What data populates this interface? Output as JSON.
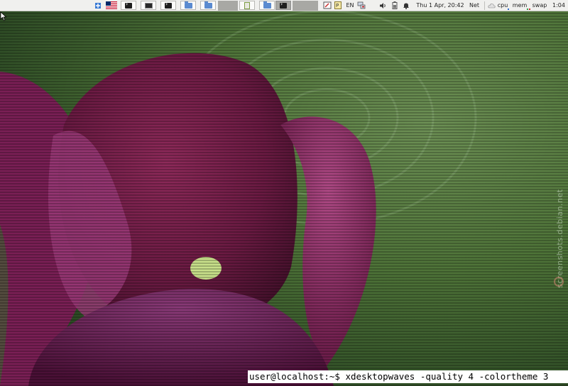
{
  "panel": {
    "apps": [
      {
        "name": "menu",
        "icon": "app-menu-icon"
      },
      {
        "name": "language-flag",
        "icon": "us-flag-icon"
      },
      {
        "name": "terminal",
        "icon": "terminal-icon"
      },
      {
        "name": "terminal-window",
        "icon": "terminal-window-icon"
      },
      {
        "name": "terminal-2",
        "icon": "terminal-icon"
      },
      {
        "name": "folder",
        "icon": "folder-icon"
      },
      {
        "name": "folder-2",
        "icon": "folder-icon"
      }
    ],
    "tasks": [
      {
        "icon": "notes-icon",
        "active": false
      },
      {
        "icon": "folder-icon",
        "active": false
      },
      {
        "icon": "terminal-icon",
        "active": true
      }
    ],
    "tray": {
      "keyboard_layout": "EN",
      "clock": "Thu  1 Apr, 20:42",
      "net_label": "Net",
      "cpu_label": "cpu",
      "mem_label": "mem",
      "swap_label": "swap",
      "load": "1:04",
      "colors": {
        "cpu": "#2f6fd0",
        "mem": "#2fa04a",
        "swap": "#c83030"
      }
    }
  },
  "desktop": {
    "watermark": "screenshots.debian.net"
  },
  "terminal": {
    "prompt": "user@localhost:~$",
    "command": "xdesktopwaves -quality 4 -colortheme 3"
  }
}
